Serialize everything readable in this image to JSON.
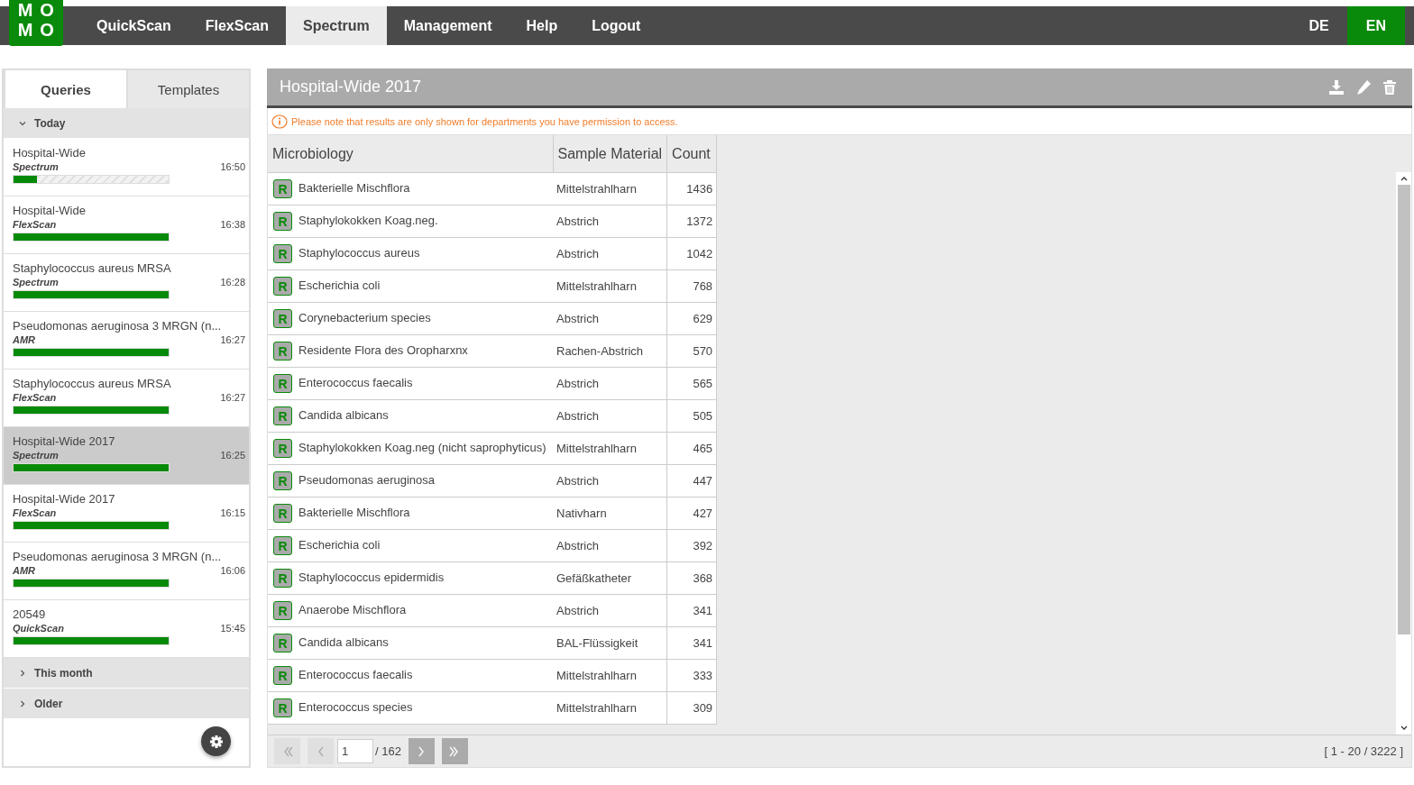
{
  "logo": {
    "letters": [
      "M",
      "O",
      "M",
      "O"
    ]
  },
  "nav": {
    "items": [
      {
        "label": "QuickScan",
        "selected": false
      },
      {
        "label": "FlexScan",
        "selected": false
      },
      {
        "label": "Spectrum",
        "selected": true
      },
      {
        "label": "Management",
        "selected": false
      },
      {
        "label": "Help",
        "selected": false
      },
      {
        "label": "Logout",
        "selected": false
      }
    ],
    "languages": [
      {
        "label": "DE",
        "selected": false
      },
      {
        "label": "EN",
        "selected": true
      }
    ]
  },
  "sidebar": {
    "tabs": [
      {
        "label": "Queries",
        "selected": true
      },
      {
        "label": "Templates",
        "selected": false
      }
    ],
    "groups": [
      {
        "label": "Today",
        "expanded": true,
        "items": [
          {
            "title": "Hospital-Wide",
            "type": "Spectrum",
            "time": "16:50",
            "level": 0.15,
            "selected": false
          },
          {
            "title": "Hospital-Wide",
            "type": "FlexScan",
            "time": "16:38",
            "level": 1,
            "selected": false
          },
          {
            "title": "Staphylococcus aureus MRSA",
            "type": "Spectrum",
            "time": "16:28",
            "level": 1,
            "selected": false
          },
          {
            "title": "Pseudomonas aeruginosa 3 MRGN (n...",
            "type": "AMR",
            "time": "16:27",
            "level": 1,
            "selected": false
          },
          {
            "title": "Staphylococcus aureus MRSA",
            "type": "FlexScan",
            "time": "16:27",
            "level": 1,
            "selected": false
          },
          {
            "title": "Hospital-Wide 2017",
            "type": "Spectrum",
            "time": "16:25",
            "level": 1,
            "selected": true
          },
          {
            "title": "Hospital-Wide 2017",
            "type": "FlexScan",
            "time": "16:15",
            "level": 1,
            "selected": false
          },
          {
            "title": "Pseudomonas aeruginosa 3 MRGN (n...",
            "type": "AMR",
            "time": "16:06",
            "level": 1,
            "selected": false
          },
          {
            "title": "20549",
            "type": "QuickScan",
            "time": "15:45",
            "level": 1,
            "selected": false
          }
        ]
      },
      {
        "label": "This month",
        "expanded": false
      },
      {
        "label": "Older",
        "expanded": false
      }
    ]
  },
  "main": {
    "title": "Hospital-Wide 2017",
    "notice": "Please note that results are only shown for departments you have permission to access.",
    "table": {
      "columns": [
        "Microbiology",
        "Sample Material",
        "Count"
      ],
      "rows": [
        {
          "badge": "R",
          "organism": "Bakterielle Mischflora",
          "material": "Mittelstrahlharn",
          "count": "1436"
        },
        {
          "badge": "R",
          "organism": "Staphylokokken Koag.neg.",
          "material": "Abstrich",
          "count": "1372"
        },
        {
          "badge": "R",
          "organism": "Staphylococcus aureus",
          "material": "Abstrich",
          "count": "1042"
        },
        {
          "badge": "R",
          "organism": "Escherichia coli",
          "material": "Mittelstrahlharn",
          "count": "768"
        },
        {
          "badge": "R",
          "organism": "Corynebacterium species",
          "material": "Abstrich",
          "count": "629"
        },
        {
          "badge": "R",
          "organism": "Residente Flora des Oropharxnx",
          "material": "Rachen-Abstrich",
          "count": "570"
        },
        {
          "badge": "R",
          "organism": "Enterococcus faecalis",
          "material": "Abstrich",
          "count": "565"
        },
        {
          "badge": "R",
          "organism": "Candida albicans",
          "material": "Abstrich",
          "count": "505"
        },
        {
          "badge": "R",
          "organism": "Staphylokokken Koag.neg (nicht saprophyticus)",
          "material": "Mittelstrahlharn",
          "count": "465"
        },
        {
          "badge": "R",
          "organism": "Pseudomonas aeruginosa",
          "material": "Abstrich",
          "count": "447"
        },
        {
          "badge": "R",
          "organism": "Bakterielle Mischflora",
          "material": "Nativharn",
          "count": "427"
        },
        {
          "badge": "R",
          "organism": "Escherichia coli",
          "material": "Abstrich",
          "count": "392"
        },
        {
          "badge": "R",
          "organism": "Staphylococcus epidermidis",
          "material": "Gefäßkatheter",
          "count": "368"
        },
        {
          "badge": "R",
          "organism": "Anaerobe Mischflora",
          "material": "Abstrich",
          "count": "341"
        },
        {
          "badge": "R",
          "organism": "Candida albicans",
          "material": "BAL-Flüssigkeit",
          "count": "341"
        },
        {
          "badge": "R",
          "organism": "Enterococcus faecalis",
          "material": "Mittelstrahlharn",
          "count": "333"
        },
        {
          "badge": "R",
          "organism": "Enterococcus species",
          "material": "Mittelstrahlharn",
          "count": "309"
        }
      ]
    },
    "pager": {
      "page": "1",
      "total": "/ 162",
      "range": "[ 1 - 20 / 3222 ]",
      "buttons": [
        {
          "kind": "first",
          "disabled": true
        },
        {
          "kind": "prev",
          "disabled": true
        },
        {
          "kind": "next",
          "disabled": false
        },
        {
          "kind": "last",
          "disabled": false
        }
      ]
    }
  }
}
